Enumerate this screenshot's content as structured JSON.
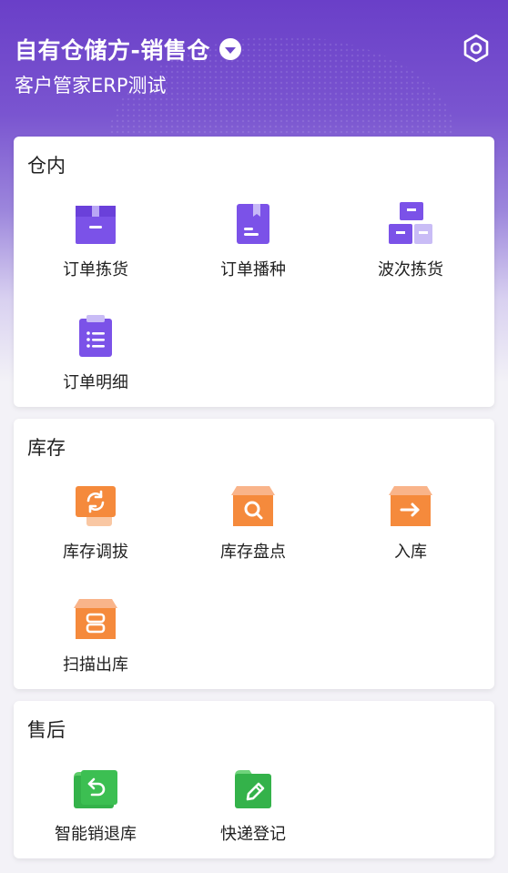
{
  "header": {
    "title": "自有仓储方-销售仓",
    "subtitle": "客户管家ERP测试",
    "dropdown_icon": "chevron-down-icon",
    "settings_icon": "settings-hex-icon"
  },
  "sections": [
    {
      "title": "仓内",
      "items": [
        {
          "label": "订单拣货",
          "icon": "order-pick-box-icon"
        },
        {
          "label": "订单播种",
          "icon": "order-sow-book-icon"
        },
        {
          "label": "波次拣货",
          "icon": "wave-pick-boxes-icon"
        },
        {
          "label": "订单明细",
          "icon": "order-detail-clipboard-icon"
        }
      ]
    },
    {
      "title": "库存",
      "items": [
        {
          "label": "库存调拔",
          "icon": "transfer-icon"
        },
        {
          "label": "库存盘点",
          "icon": "stocktake-icon"
        },
        {
          "label": "入库",
          "icon": "inbound-icon"
        },
        {
          "label": "扫描出库",
          "icon": "scan-outbound-icon"
        }
      ]
    },
    {
      "title": "售后",
      "items": [
        {
          "label": "智能销退库",
          "icon": "return-icon"
        },
        {
          "label": "快递登记",
          "icon": "courier-register-icon"
        }
      ]
    }
  ],
  "colors": {
    "purple": "#7b52e8",
    "orange": "#f58a3c",
    "green": "#34b24a"
  }
}
